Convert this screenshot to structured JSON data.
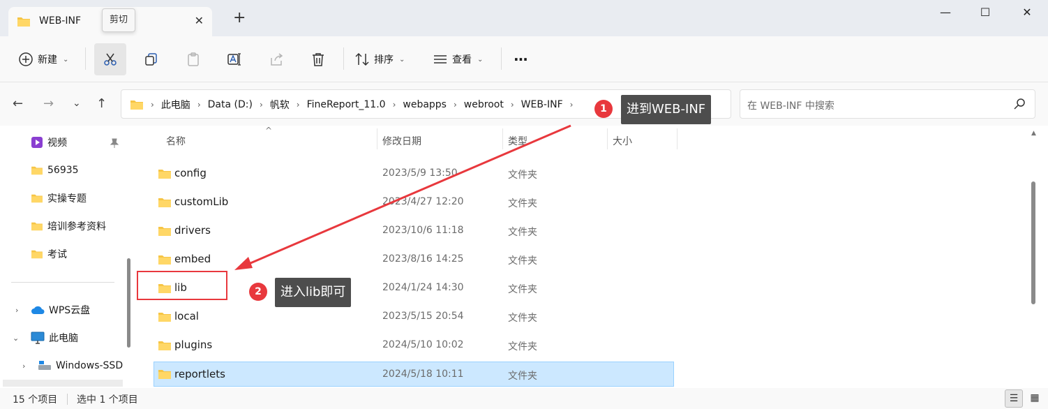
{
  "window": {
    "tab_title": "WEB-INF",
    "tooltip": "剪切",
    "new_tab": "+",
    "minimize": "—",
    "maximize": "☐",
    "close": "✕"
  },
  "toolbar": {
    "new_label": "新建",
    "sort_label": "排序",
    "view_label": "查看",
    "more_label": "···"
  },
  "address": {
    "crumbs": [
      "此电脑",
      "Data (D:)",
      "帆软",
      "FineReport_11.0",
      "webapps",
      "webroot",
      "WEB-INF"
    ],
    "search_placeholder": "在 WEB-INF 中搜索"
  },
  "annotations": {
    "step1_number": "1",
    "step1_text": "进到WEB-INF",
    "step2_number": "2",
    "step2_text": "进入lib即可",
    "accent_color": "#e8383d"
  },
  "sidebar": {
    "items": [
      {
        "label": "视频",
        "icon": "video-icon"
      },
      {
        "label": "56935",
        "icon": "folder-icon"
      },
      {
        "label": "实操专题",
        "icon": "folder-icon"
      },
      {
        "label": "培训参考资料",
        "icon": "folder-icon"
      },
      {
        "label": "考试",
        "icon": "folder-icon"
      }
    ],
    "tree": [
      {
        "label": "WPS云盘",
        "icon": "cloud-icon"
      },
      {
        "label": "此电脑",
        "icon": "computer-icon"
      },
      {
        "label": "Windows-SSD",
        "icon": "drive-icon"
      }
    ]
  },
  "columns": {
    "name": "名称",
    "date": "修改日期",
    "type": "类型",
    "size": "大小"
  },
  "files": [
    {
      "name": "config",
      "date": "2023/5/9 13:50",
      "type": "文件夹"
    },
    {
      "name": "customLib",
      "date": "2023/4/27 12:20",
      "type": "文件夹"
    },
    {
      "name": "drivers",
      "date": "2023/10/6 11:18",
      "type": "文件夹"
    },
    {
      "name": "embed",
      "date": "2023/8/16 14:25",
      "type": "文件夹"
    },
    {
      "name": "lib",
      "date": "2024/1/24 14:30",
      "type": "文件夹"
    },
    {
      "name": "local",
      "date": "2023/5/15 20:54",
      "type": "文件夹"
    },
    {
      "name": "plugins",
      "date": "2024/5/10 10:02",
      "type": "文件夹"
    },
    {
      "name": "reportlets",
      "date": "2024/5/18 10:11",
      "type": "文件夹",
      "selected": true
    }
  ],
  "status": {
    "item_count": "15 个项目",
    "selected": "选中 1 个项目"
  }
}
